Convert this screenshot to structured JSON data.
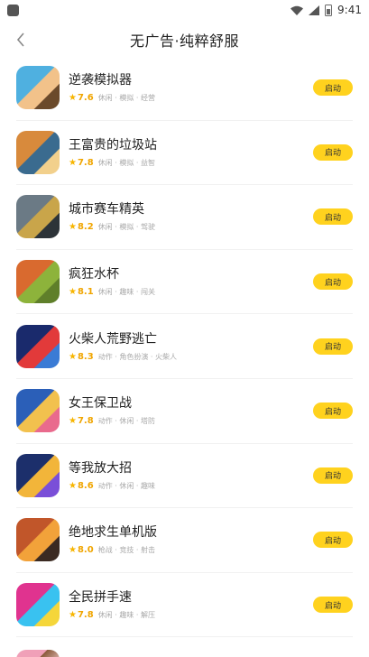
{
  "status": {
    "time": "9:41"
  },
  "header": {
    "title": "无广告·纯粹舒服"
  },
  "games": [
    {
      "name": "逆袭模拟器",
      "rating": "7.6",
      "tags": "休闲 · 模拟 · 经营",
      "button": "启动",
      "colors": [
        "#4fb0e0",
        "#f2c28a",
        "#6b4a2b"
      ]
    },
    {
      "name": "王富贵的垃圾站",
      "rating": "7.8",
      "tags": "休闲 · 模拟 · 益智",
      "button": "启动",
      "colors": [
        "#d88a3c",
        "#3a6b8f",
        "#f2d08c"
      ]
    },
    {
      "name": "城市赛车精英",
      "rating": "8.2",
      "tags": "休闲 · 模拟 · 驾驶",
      "button": "启动",
      "colors": [
        "#6b7a85",
        "#c9a54a",
        "#2c3338"
      ]
    },
    {
      "name": "疯狂水杯",
      "rating": "8.1",
      "tags": "休闲 · 趣味 · 闯关",
      "button": "启动",
      "colors": [
        "#d96a2f",
        "#8db33b",
        "#5f7f2a"
      ]
    },
    {
      "name": "火柴人荒野逃亡",
      "rating": "8.3",
      "tags": "动作 · 角色扮演 · 火柴人",
      "button": "启动",
      "colors": [
        "#1a2a6c",
        "#e23a3a",
        "#3a7bd5"
      ]
    },
    {
      "name": "女王保卫战",
      "rating": "7.8",
      "tags": "动作 · 休闲 · 塔防",
      "button": "启动",
      "colors": [
        "#2b5fb8",
        "#f2c14e",
        "#e96a8d"
      ]
    },
    {
      "name": "等我放大招",
      "rating": "8.6",
      "tags": "动作 · 休闲 · 趣味",
      "button": "启动",
      "colors": [
        "#1c2f6b",
        "#f2b53a",
        "#7a4fd8"
      ]
    },
    {
      "name": "绝地求生单机版",
      "rating": "8.0",
      "tags": "枪战 · 竞技 · 射击",
      "button": "启动",
      "colors": [
        "#c1562a",
        "#f2a23a",
        "#3b2a22"
      ]
    },
    {
      "name": "全民拼手速",
      "rating": "7.8",
      "tags": "休闲 · 趣味 · 解压",
      "button": "启动",
      "colors": [
        "#e0338f",
        "#39c2f0",
        "#f5d63a"
      ]
    }
  ],
  "partial_icon_colors": [
    "#f0a0b8",
    "#8a5a3a",
    "#f6d2d2"
  ]
}
